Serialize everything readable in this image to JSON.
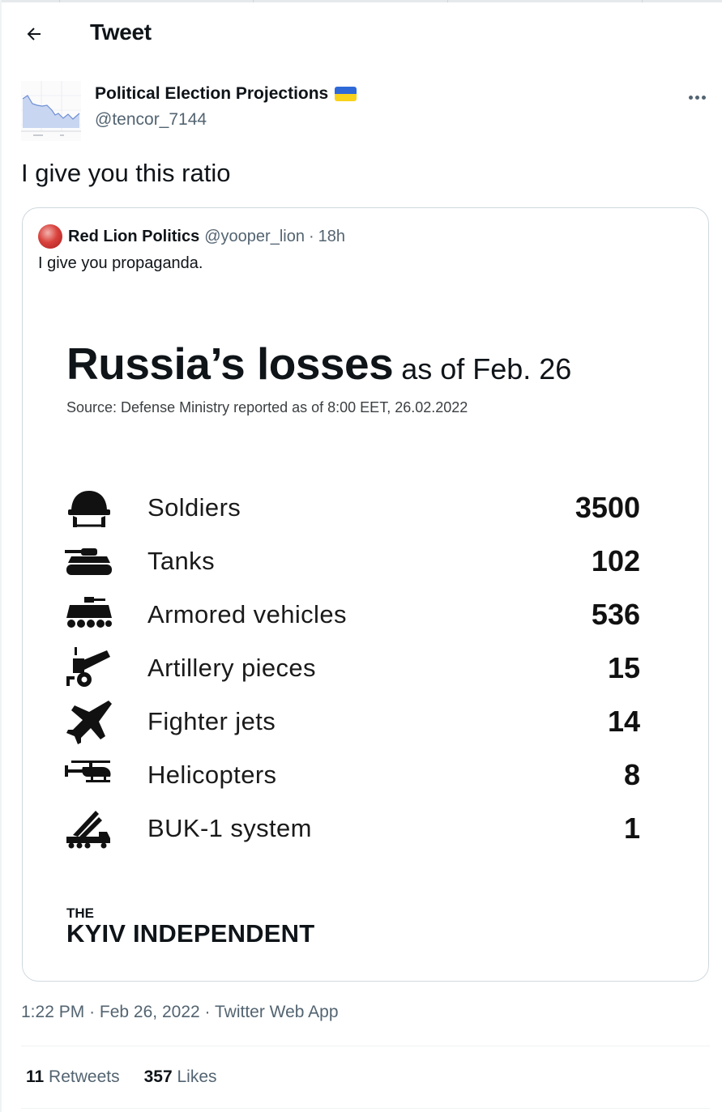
{
  "header": {
    "title": "Tweet",
    "back_icon": "arrow-left-icon"
  },
  "author": {
    "name": "Political Election Projections",
    "handle": "@tencor_7144",
    "flag_colors": [
      "#2f69d8",
      "#f9d21b"
    ]
  },
  "tweet": {
    "text": "I give you this ratio"
  },
  "quote": {
    "name": "Red Lion Politics",
    "handle": "@yooper_lion",
    "separator": "·",
    "time": "18h",
    "text": "I give you propaganda.",
    "image": {
      "title": "Russia’s losses",
      "subtitle": "as of Feb. 26",
      "source": "Source: Defense Ministry reported as of 8:00 EET, 26.02.2022",
      "rows": [
        {
          "label": "Soldiers",
          "value": "3500",
          "icon": "helmet-icon"
        },
        {
          "label": "Tanks",
          "value": "102",
          "icon": "tank-icon"
        },
        {
          "label": "Armored vehicles",
          "value": "536",
          "icon": "armored-vehicle-icon"
        },
        {
          "label": "Artillery pieces",
          "value": "15",
          "icon": "artillery-icon"
        },
        {
          "label": "Fighter jets",
          "value": "14",
          "icon": "fighter-jet-icon"
        },
        {
          "label": "Helicopters",
          "value": "8",
          "icon": "helicopter-icon"
        },
        {
          "label": "BUK-1 system",
          "value": "1",
          "icon": "missile-launcher-icon"
        }
      ],
      "brand_the": "THE",
      "brand_name": "KYIV INDEPENDENT"
    }
  },
  "meta": {
    "time": "1:22 PM",
    "sep1": "·",
    "date": "Feb 26, 2022",
    "sep2": "·",
    "source": "Twitter Web App"
  },
  "stats": {
    "retweets_count": "11",
    "retweets_label": "Retweets",
    "likes_count": "357",
    "likes_label": "Likes"
  }
}
